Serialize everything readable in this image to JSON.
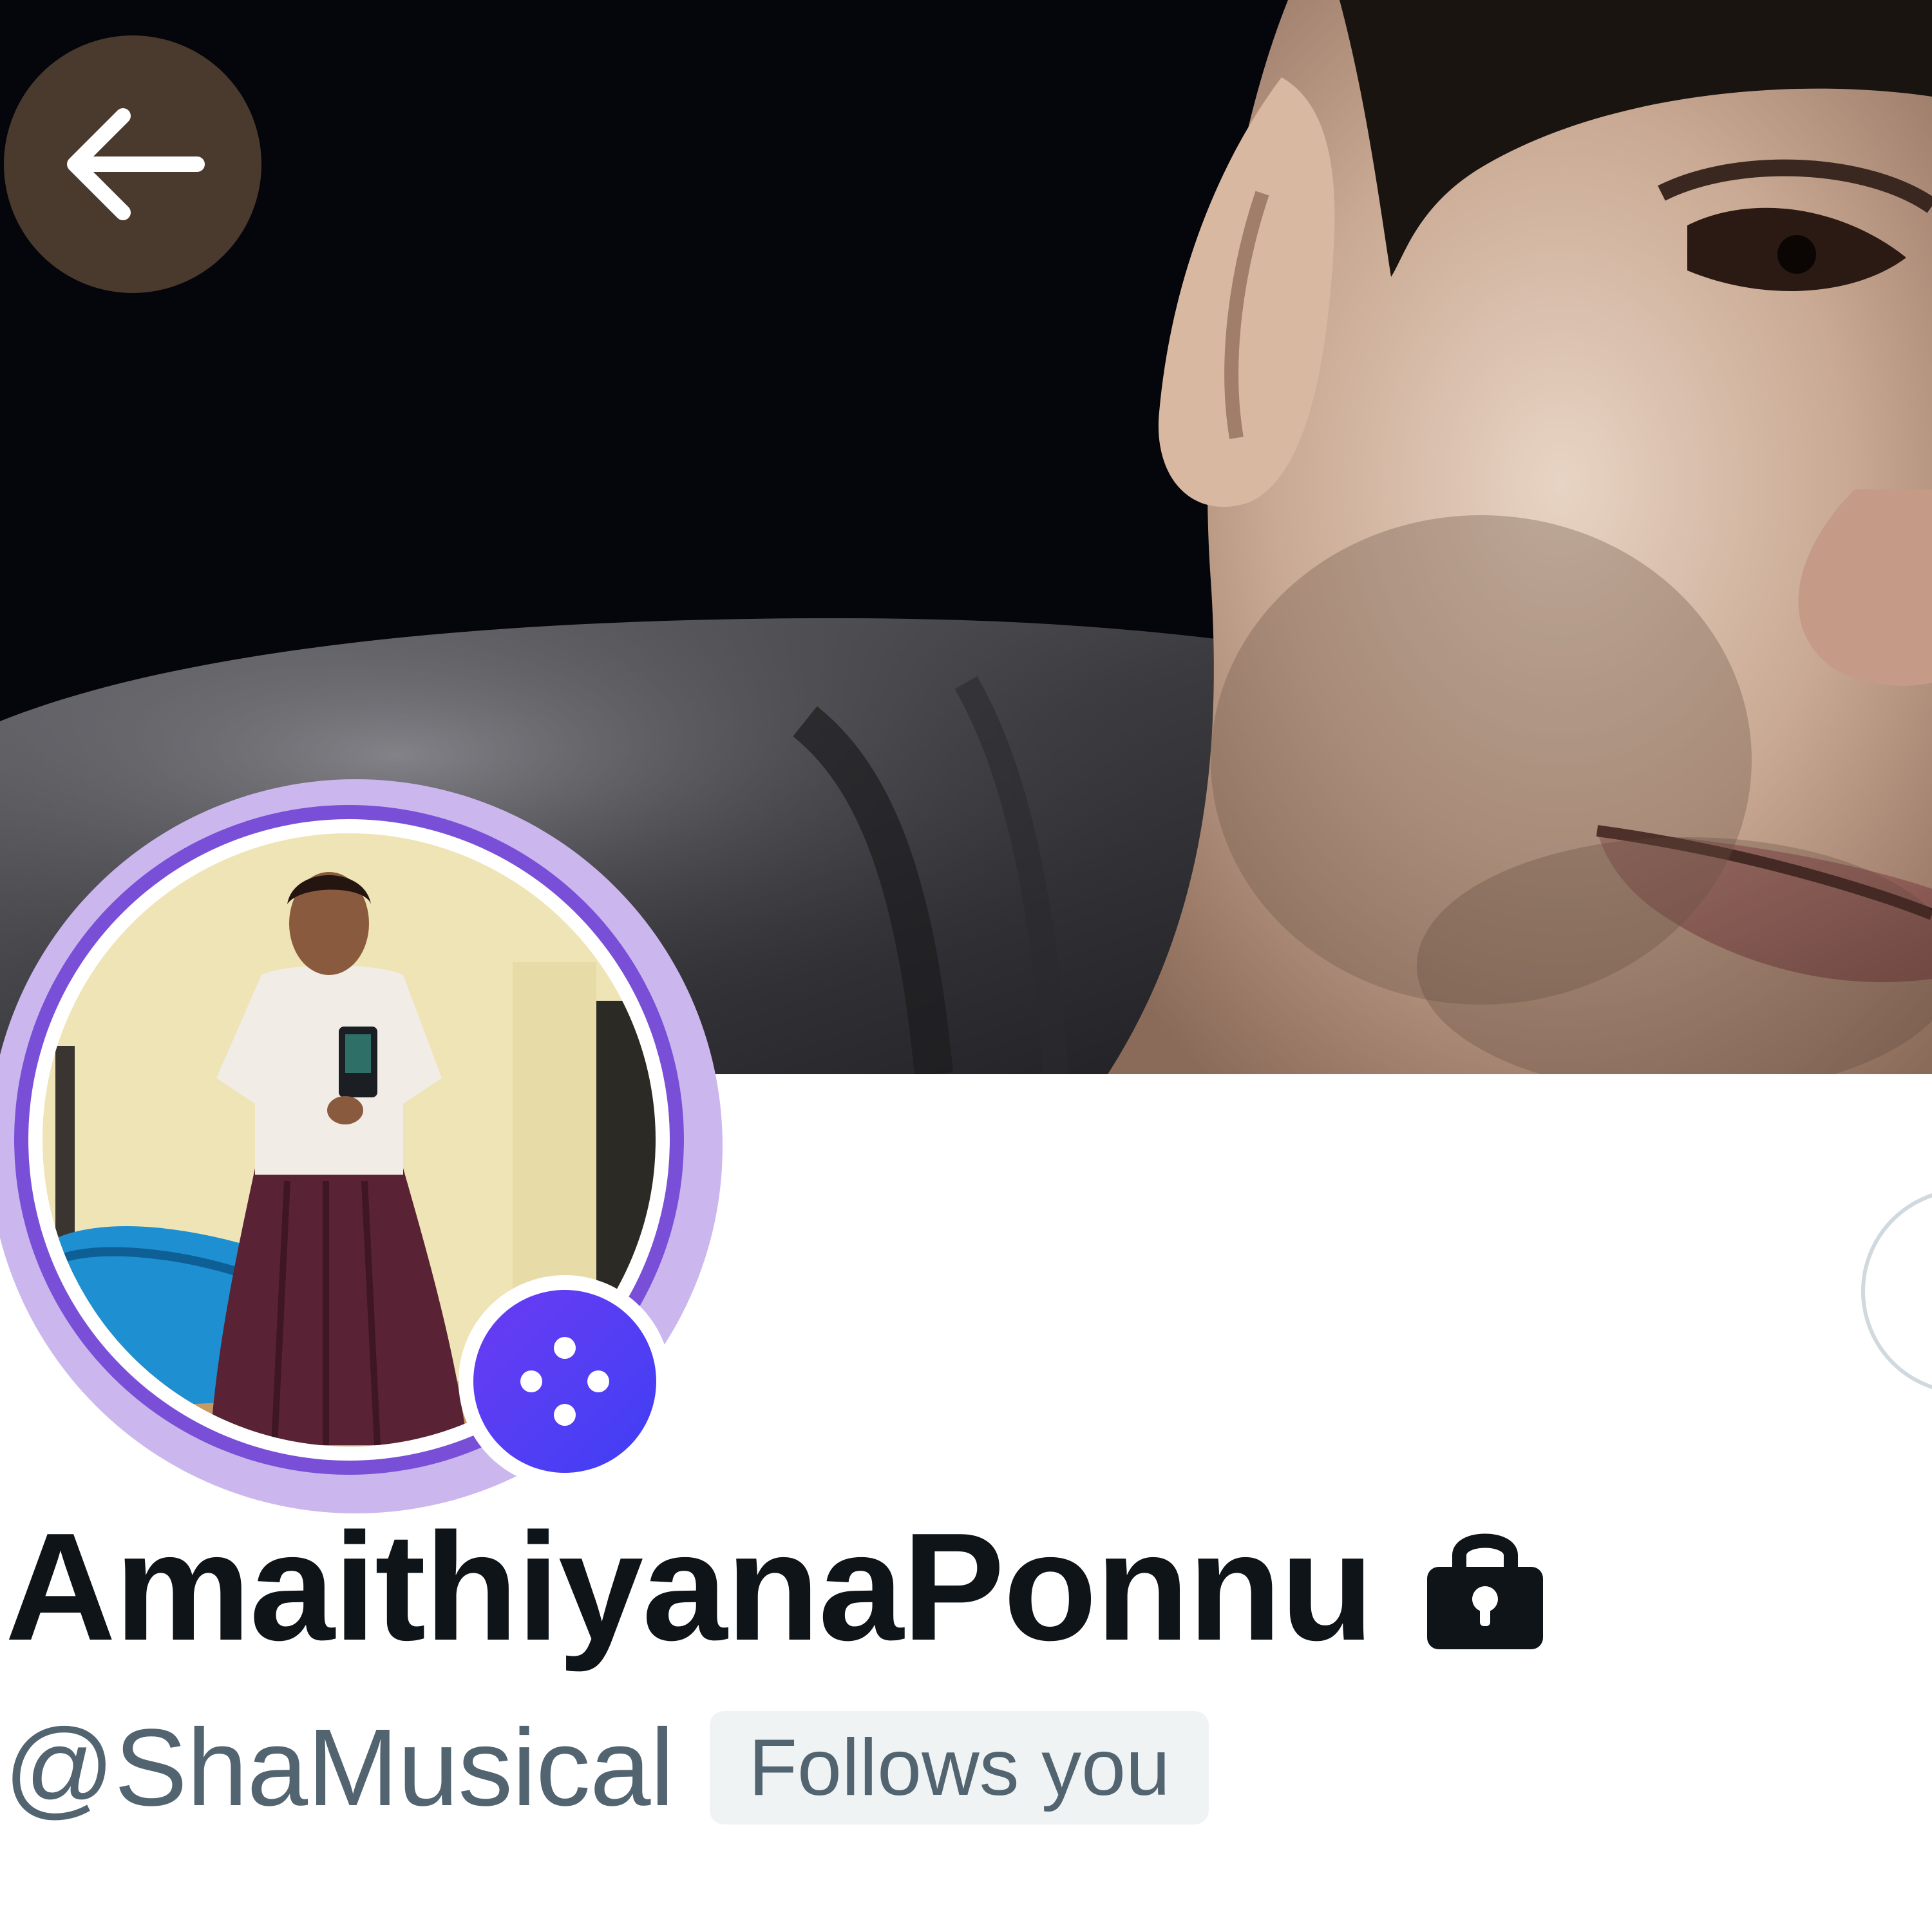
{
  "header": {
    "back_icon": "arrow-left-icon",
    "banner_alt": "profile header photo"
  },
  "avatar": {
    "badge_icon": "community-dots-icon",
    "ring_color": "#7a4fd8",
    "badge_color": "#4a3ff4"
  },
  "profile": {
    "display_name": "AmaithiyanaPonnu",
    "protected_icon": "lock-icon",
    "handle": "@ShaMusical",
    "follows_you_label": "Follows you"
  },
  "colors": {
    "name": "#0f1419",
    "secondary_text": "#536471",
    "badge_bg": "#eff3f4",
    "back_button_bg": "#4a3a2e"
  }
}
